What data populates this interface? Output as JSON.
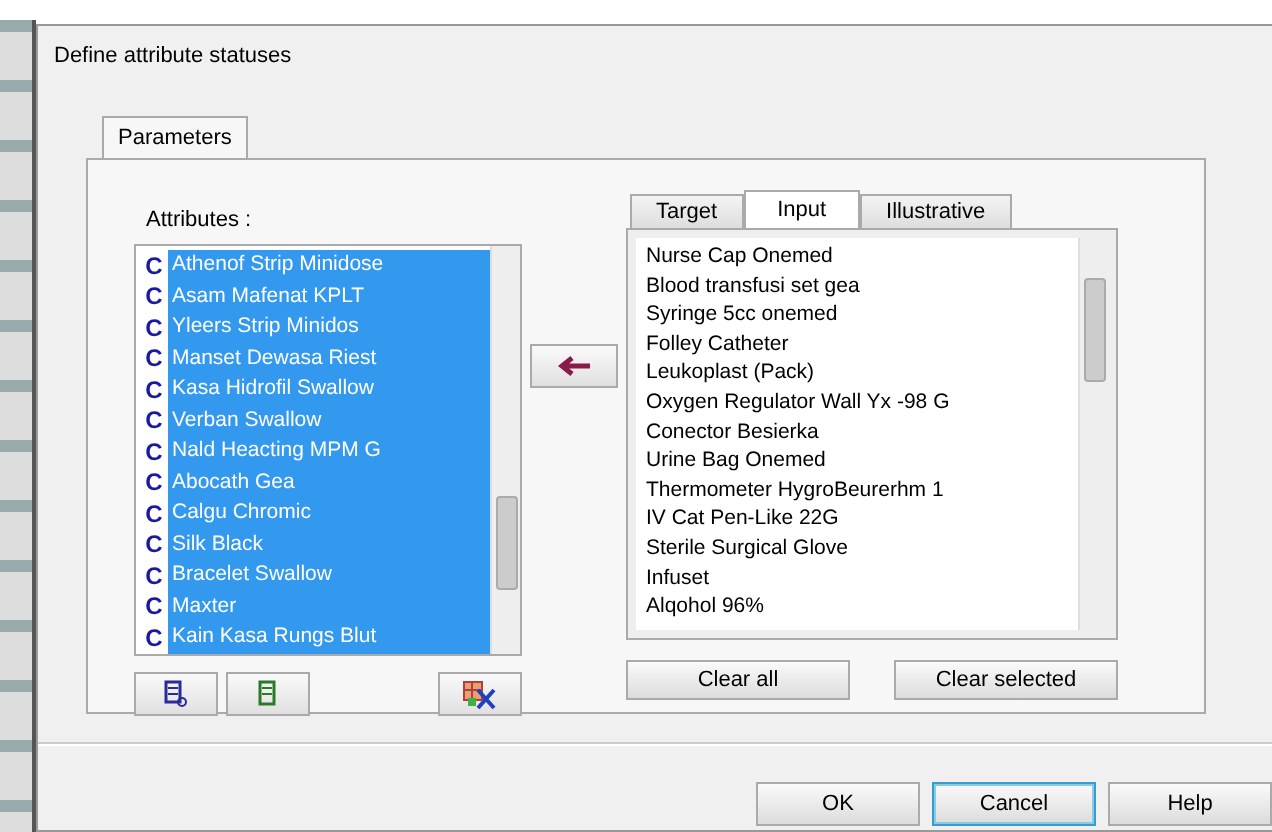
{
  "window": {
    "title": "Define attribute statuses"
  },
  "tabs": [
    {
      "label": "Parameters",
      "selected": true
    }
  ],
  "attributes": {
    "label": "Attributes :",
    "items": [
      {
        "icon": "C",
        "text": "Athenof Strip Minidose",
        "selected": true
      },
      {
        "icon": "C",
        "text": "Asam Mafenat KPLT",
        "selected": true
      },
      {
        "icon": "C",
        "text": "Yleers Strip Minidos",
        "selected": true
      },
      {
        "icon": "C",
        "text": "Manset Dewasa Riest",
        "selected": true
      },
      {
        "icon": "C",
        "text": "Kasa Hidrofil Swallow",
        "selected": true
      },
      {
        "icon": "C",
        "text": "Verban Swallow",
        "selected": true
      },
      {
        "icon": "C",
        "text": "Nald Heacting MPM G",
        "selected": true
      },
      {
        "icon": "C",
        "text": "Abocath Gea",
        "selected": true
      },
      {
        "icon": "C",
        "text": "Calgu Chromic",
        "selected": true
      },
      {
        "icon": "C",
        "text": "Silk Black",
        "selected": true
      },
      {
        "icon": "C",
        "text": "Bracelet Swallow",
        "selected": true
      },
      {
        "icon": "C",
        "text": "Maxter",
        "selected": true
      },
      {
        "icon": "C",
        "text": "Kain Kasa Rungs Blut",
        "selected": true
      }
    ]
  },
  "right_tabs": [
    {
      "label": "Target",
      "selected": false
    },
    {
      "label": "Input",
      "selected": true
    },
    {
      "label": "Illustrative",
      "selected": false
    }
  ],
  "input_items": [
    "Nurse Cap Onemed",
    "Blood transfusi set gea",
    "Syringe 5cc onemed",
    "Folley Catheter",
    "Leukoplast (Pack)",
    "Oxygen Regulator Wall Yx -98 G",
    "Conector Besierka",
    "Urine Bag Onemed",
    "Thermometer HygroBeurerhm 1",
    "IV Cat Pen-Like 22G",
    "Sterile Surgical Glove",
    "Infuset",
    "Alqohol 96%"
  ],
  "list_buttons": [
    "Clear all",
    "Clear selected"
  ],
  "buttons": [
    {
      "label": "OK",
      "default": false
    },
    {
      "label": "Cancel",
      "default": true
    },
    {
      "label": "Help",
      "default": false
    }
  ]
}
